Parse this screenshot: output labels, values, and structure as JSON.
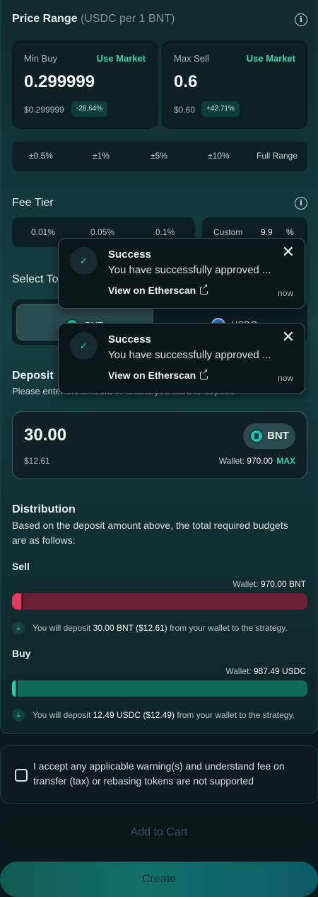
{
  "price_range": {
    "title": "Price Range",
    "unit": "(USDC per 1 BNT)",
    "info_icon": "info-icon",
    "min_buy": {
      "label": "Min Buy",
      "use_market": "Use Market",
      "value": "0.299999",
      "usd": "$0.299999",
      "change": "-28.64%"
    },
    "max_sell": {
      "label": "Max Sell",
      "use_market": "Use Market",
      "value": "0.6",
      "usd": "$0.60",
      "change": "+42.71%"
    },
    "range_options": [
      "±0.5%",
      "±1%",
      "±5%",
      "±10%",
      "Full Range"
    ]
  },
  "fee_tier": {
    "title": "Fee Tier",
    "info_icon": "info-icon",
    "options": [
      "0.01%",
      "0.05%",
      "0.1%"
    ],
    "custom_label": "Custom",
    "custom_value": "9.9",
    "custom_unit": "%"
  },
  "select_token": {
    "title": "Select To",
    "tokens": [
      "BNT",
      "USDC"
    ],
    "selected": "BNT"
  },
  "deposit": {
    "title": "Deposit",
    "subtitle": "Please enter the amount of tokens you want to deposit",
    "amount": "30.00",
    "token": "BNT",
    "usd": "$12.61",
    "wallet_label": "Wallet:",
    "wallet_value": "970.00",
    "max_label": "MAX"
  },
  "distribution": {
    "title": "Distribution",
    "description_line1": "Based on the deposit amount above, the total required budgets",
    "description_line2": "are as follows:",
    "sell": {
      "label": "Sell",
      "wallet_label": "Wallet:",
      "wallet_value": "970.00 BNT",
      "fill_fraction": 0.03,
      "note_prefix": "You will deposit",
      "note_amount": "30.00 BNT ($12.61)",
      "note_suffix": "from your wallet to the strategy.",
      "color": "#e8365e"
    },
    "buy": {
      "label": "Buy",
      "wallet_label": "Wallet:",
      "wallet_value": "987.49 USDC",
      "fill_fraction": 0.013,
      "note_prefix": "You will deposit",
      "note_amount": "12.49 USDC ($12.49)",
      "note_suffix": "from your wallet to the strategy.",
      "color": "#0ea57a"
    }
  },
  "accept": {
    "line1": "I accept any applicable warning(s) and understand fee on",
    "line2": "transfer (tax) or rebasing tokens are not supported",
    "checked": false
  },
  "buttons": {
    "add_to_cart": "Add to Cart",
    "create": "Create"
  },
  "toasts": [
    {
      "title": "Success",
      "message": "You have successfully approved ...",
      "link": "View on Etherscan",
      "time": "now"
    },
    {
      "title": "Success",
      "message": "You have successfully approved ...",
      "link": "View on Etherscan",
      "time": "now"
    }
  ],
  "colors": {
    "accent": "#2fd5b8",
    "sell": "#e8365e",
    "buy": "#0ea57a"
  }
}
